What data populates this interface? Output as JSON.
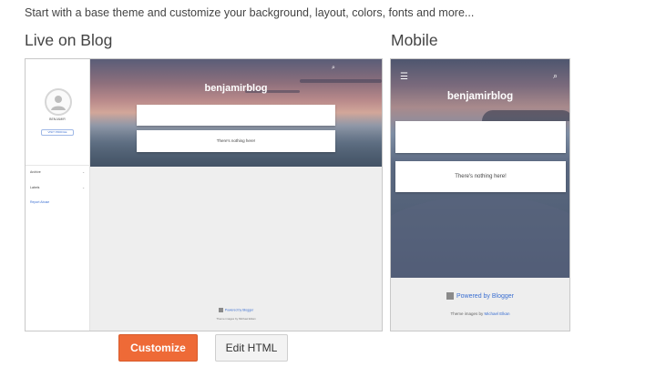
{
  "intro": "Start with a base theme and customize your background, layout, colors, fonts and more...",
  "live_title": "Live on Blog",
  "mobile_title": "Mobile",
  "desktop": {
    "blog_title": "benjamirblog",
    "search_icon": "search-icon",
    "sidebar": {
      "name": "BENJAMIR",
      "button": "VISIT PROFILE",
      "items": [
        {
          "label": "Archive",
          "icon": "chevron-down-icon"
        },
        {
          "label": "Labels",
          "icon": "chevron-down-icon"
        }
      ],
      "link": "Report Abuse"
    },
    "empty_message": "There's nothing here!",
    "powered": "Powered by Blogger",
    "theme_credit": "Theme images by Michael Elkan"
  },
  "mobile": {
    "blog_title": "benjamirblog",
    "menu_icon": "hamburger-menu-icon",
    "search_icon": "search-icon",
    "empty_message": "There's nothing here!",
    "powered": "Powered by Blogger",
    "theme_prefix": "Theme images by",
    "theme_author": "Michael Elkan"
  },
  "buttons": {
    "customize": "Customize",
    "edit_html": "Edit HTML"
  },
  "colors": {
    "accent": "#ee6a37",
    "link": "#3b6fd1"
  }
}
